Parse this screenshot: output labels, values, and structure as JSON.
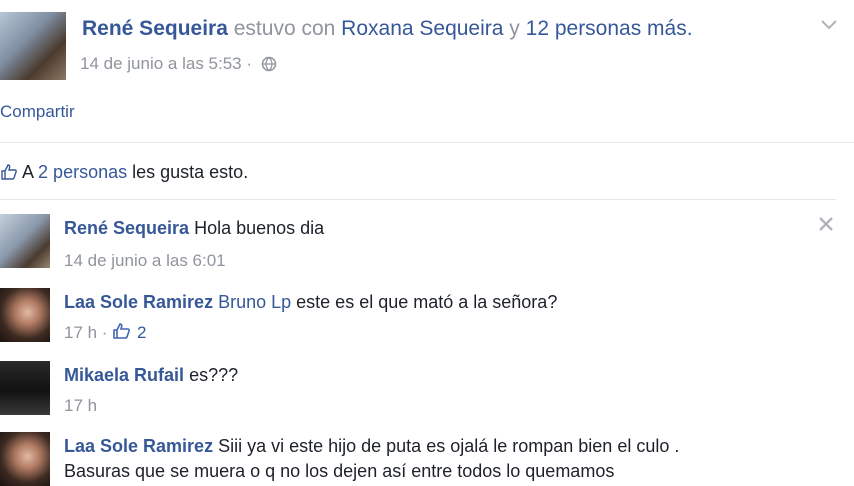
{
  "post": {
    "author": "René Sequeira",
    "with_text": "estuvo con",
    "tagged": "Roxana Sequeira",
    "and_text": "y",
    "others": "12 personas más.",
    "date": "14 de junio a las 5:53 ·"
  },
  "actions": {
    "share": "Compartir"
  },
  "likes": {
    "prefix": "A",
    "people": "2 personas",
    "suffix": "les gusta esto."
  },
  "comments": [
    {
      "author": "René Sequeira",
      "text": "Hola buenos dia",
      "meta": "14 de junio a las 6:01"
    },
    {
      "author": "Laa Sole Ramirez",
      "mention": "Bruno Lp",
      "text": "este es el que mató a la señora?",
      "meta": "17 h ·",
      "likes": "2"
    },
    {
      "author": "Mikaela Rufail",
      "text": "es???",
      "meta": "17 h"
    },
    {
      "author": "Laa Sole Ramirez",
      "text": "Siii ya vi este hijo de puta es ojalá le rompan bien el culo .",
      "text2": "Basuras que se muera o q no los dejen así entre todos lo quemamos"
    }
  ],
  "colors": {
    "link": "#365899",
    "muted": "#90949c",
    "text": "#1d2129",
    "divider": "#e5e6e9"
  }
}
